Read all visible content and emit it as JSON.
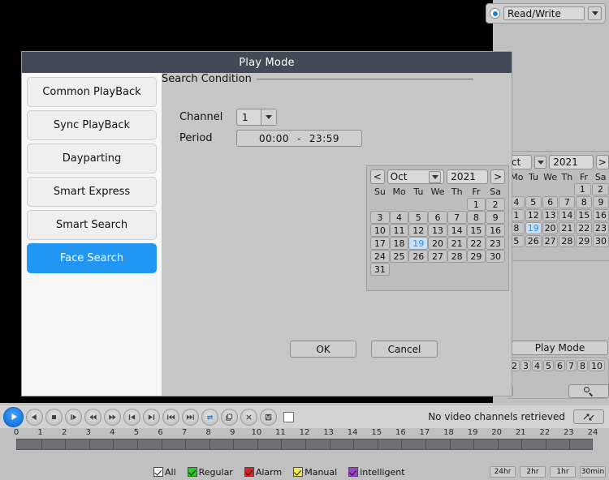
{
  "read_write_selector": {
    "label": "Read/Write",
    "radio_icon": "radio-selected-icon",
    "dropdown_icon": "chevron-down-icon"
  },
  "dialog": {
    "title": "Play Mode",
    "sidebar": [
      {
        "label": "Common PlayBack",
        "active": false
      },
      {
        "label": "Sync PlayBack",
        "active": false
      },
      {
        "label": "Dayparting",
        "active": false
      },
      {
        "label": "Smart Express",
        "active": false
      },
      {
        "label": "Smart Search",
        "active": false
      },
      {
        "label": "Face Search",
        "active": true
      }
    ],
    "fields": {
      "channel_label": "Channel",
      "channel_value": "1",
      "period_label": "Period",
      "period_start": "00:00",
      "period_dash": "-",
      "period_end": "23:59",
      "search_condition_label": "Search Condition"
    },
    "calendar": {
      "prev_label": "<",
      "next_label": ">",
      "month": "Oct",
      "year": "2021",
      "dow": [
        "Su",
        "Mo",
        "Tu",
        "We",
        "Th",
        "Fr",
        "Sa"
      ],
      "leading_blanks": 5,
      "days": [
        1,
        2,
        3,
        4,
        5,
        6,
        7,
        8,
        9,
        10,
        11,
        12,
        13,
        14,
        15,
        16,
        17,
        18,
        19,
        20,
        21,
        22,
        23,
        24,
        25,
        26,
        27,
        28,
        29,
        30,
        31
      ],
      "selected_day": 19,
      "selected_color": "#2f8fe8"
    },
    "buttons": {
      "ok": "OK",
      "cancel": "Cancel"
    },
    "title_bar_color": "#414a56",
    "accent_color": "#2196f3"
  },
  "background_panel": {
    "calendar": {
      "month_partial": "ct",
      "year": "2021",
      "next_label": ">",
      "dow": [
        "Mo",
        "Tu",
        "We",
        "Th",
        "Fr",
        "Sa"
      ],
      "row_1": [
        "",
        "",
        "",
        "",
        "1",
        "2"
      ],
      "row_2": [
        "4",
        "5",
        "6",
        "7",
        "8",
        "9"
      ],
      "row_3": [
        "1",
        "12",
        "13",
        "14",
        "15",
        "16"
      ],
      "row_4": [
        "8",
        "19",
        "20",
        "21",
        "22",
        "23"
      ],
      "row_5": [
        "5",
        "26",
        "27",
        "28",
        "29",
        "30"
      ],
      "selected_day": "19"
    },
    "play_mode_button": "Play Mode",
    "channels": [
      "2",
      "3",
      "4",
      "5",
      "6",
      "7",
      "8",
      "10"
    ],
    "search_icon": "magnifier-icon"
  },
  "control_bar": {
    "buttons": [
      {
        "name": "play-button",
        "icon": "play-icon",
        "primary": true
      },
      {
        "name": "reverse-play-button",
        "icon": "play-reverse-icon",
        "primary": false
      },
      {
        "name": "stop-button",
        "icon": "stop-icon",
        "primary": false
      },
      {
        "name": "slow-play-button",
        "icon": "slow-play-icon",
        "primary": false
      },
      {
        "name": "rewind-button",
        "icon": "rewind-icon",
        "primary": false
      },
      {
        "name": "fast-forward-button",
        "icon": "fast-forward-icon",
        "primary": false
      },
      {
        "name": "previous-frame-button",
        "icon": "skip-previous-icon",
        "primary": false
      },
      {
        "name": "next-frame-button",
        "icon": "skip-next-icon",
        "primary": false
      },
      {
        "name": "previous-file-button",
        "icon": "skip-to-start-icon",
        "primary": false
      },
      {
        "name": "next-file-button",
        "icon": "skip-to-end-icon",
        "primary": false
      },
      {
        "name": "clip-record-button",
        "icon": "clip-icon",
        "primary": false
      },
      {
        "name": "snapshot-button",
        "icon": "snapshot-icon",
        "primary": false
      },
      {
        "name": "close-clip-button",
        "icon": "close-x-icon",
        "primary": false
      },
      {
        "name": "save-button",
        "icon": "save-disk-icon",
        "primary": false
      }
    ],
    "stop_checkbox_icon": "square-checkbox-icon",
    "status_text": "No video channels retrieved",
    "refresh_icon": "refresh-arrows-icon"
  },
  "timeline": {
    "hours": [
      "0",
      "1",
      "2",
      "3",
      "4",
      "5",
      "6",
      "7",
      "8",
      "9",
      "10",
      "11",
      "12",
      "13",
      "14",
      "15",
      "16",
      "17",
      "18",
      "19",
      "20",
      "21",
      "22",
      "23",
      "24"
    ],
    "bar_color": "#6f7073"
  },
  "legend": {
    "items": [
      {
        "label": "All",
        "color": "#ffffff"
      },
      {
        "label": "Regular",
        "color": "#22cc22"
      },
      {
        "label": "Alarm",
        "color": "#e02020"
      },
      {
        "label": "Manual",
        "color": "#f2ea54"
      },
      {
        "label": "intelligent",
        "color": "#9b3fd4"
      }
    ],
    "time_buttons": [
      "24hr",
      "2hr",
      "1hr",
      "30min"
    ]
  }
}
